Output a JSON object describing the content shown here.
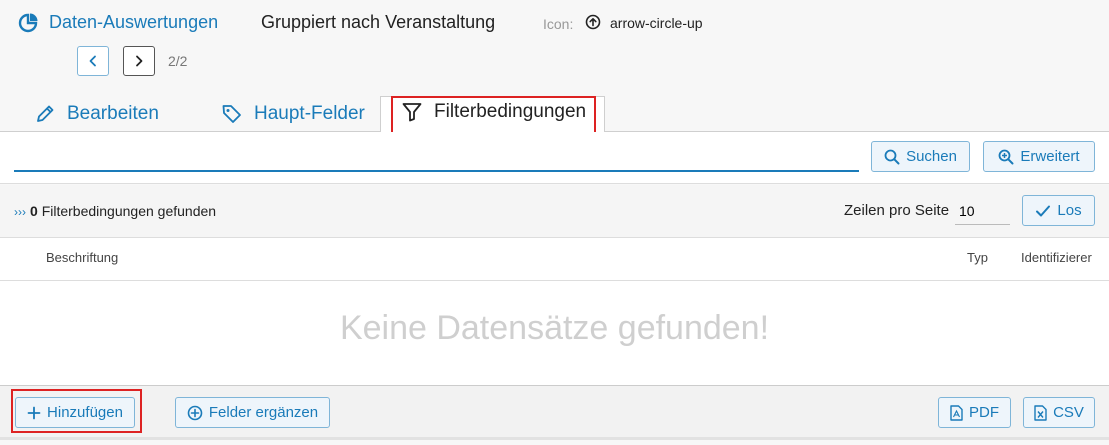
{
  "header": {
    "app_title": "Daten-Auswertungen",
    "record_title": "Gruppiert nach Veranstaltung",
    "icon_label": "Icon:",
    "icon_name": "arrow-circle-up",
    "page_indicator": "2/2"
  },
  "tabs": [
    {
      "label": "Bearbeiten",
      "icon": "pencil-icon"
    },
    {
      "label": "Haupt-Felder",
      "icon": "tag-icon"
    },
    {
      "label": "Filterbedingungen",
      "icon": "filter-icon",
      "active": true
    }
  ],
  "search": {
    "value": "",
    "search_label": "Suchen",
    "advanced_label": "Erweitert"
  },
  "results": {
    "count": "0",
    "count_suffix": "Filterbedingungen gefunden",
    "rows_label": "Zeilen pro Seite",
    "rows_value": "10",
    "go_label": "Los"
  },
  "table": {
    "columns": [
      "Beschriftung",
      "Typ",
      "Identifizierer"
    ],
    "empty_message": "Keine Datensätze gefunden!"
  },
  "footer": {
    "add_label": "Hinzufügen",
    "add_fields_label": "Felder ergänzen",
    "pdf_label": "PDF",
    "csv_label": "CSV"
  },
  "colors": {
    "accent": "#1a7bb9",
    "highlight": "#dd2222"
  }
}
